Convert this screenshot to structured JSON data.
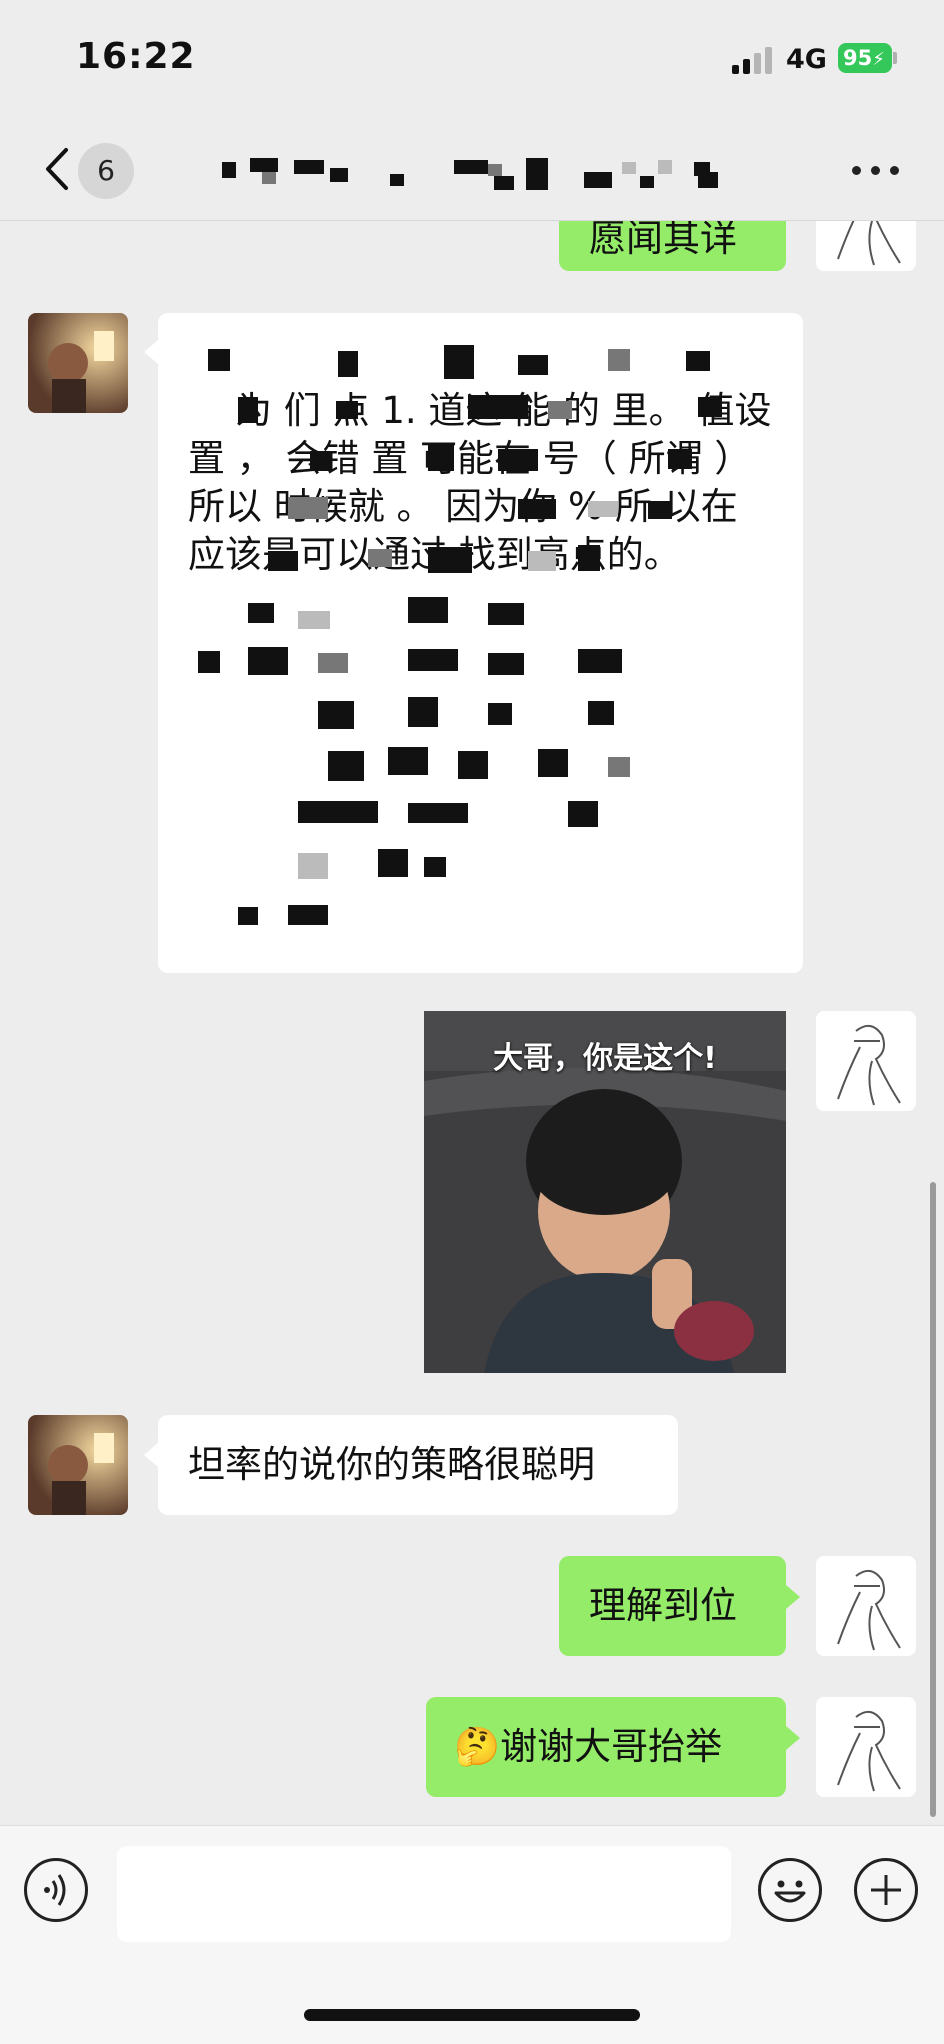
{
  "status_bar": {
    "time": "16:22",
    "network": "4G",
    "battery": "95",
    "battery_color": "#34c759"
  },
  "nav_bar": {
    "back_icon": "chevron-left-icon",
    "unread_count": "6",
    "title": "",
    "more_icon": "more-dots-icon"
  },
  "messages": [
    {
      "sender": "self",
      "type": "text",
      "text": "愿闻其详"
    },
    {
      "sender": "other",
      "type": "text",
      "text": "为 们 点 1. 道这 能 的 里。 值设 置 ， 会错 置 可能在 号（ 所谓 ） 所以 时候就 。 因为你 % 所 以在 应该是可以通过 找到高点的。"
    },
    {
      "sender": "self",
      "type": "sticker",
      "caption": "大哥，你是这个!"
    },
    {
      "sender": "other",
      "type": "text",
      "text": "坦率的说你的策略很聪明"
    },
    {
      "sender": "self",
      "type": "text",
      "text": "理解到位"
    },
    {
      "sender": "self",
      "type": "text",
      "text": "谢谢大哥抬举",
      "emoji": "🤔"
    }
  ],
  "input_bar": {
    "placeholder": "",
    "voice_icon": "voice-icon",
    "emoji_icon": "emoji-icon",
    "plus_icon": "plus-icon"
  },
  "colors": {
    "outgoing_bubble": "#95ec69",
    "incoming_bubble": "#ffffff",
    "background": "#ededed"
  }
}
